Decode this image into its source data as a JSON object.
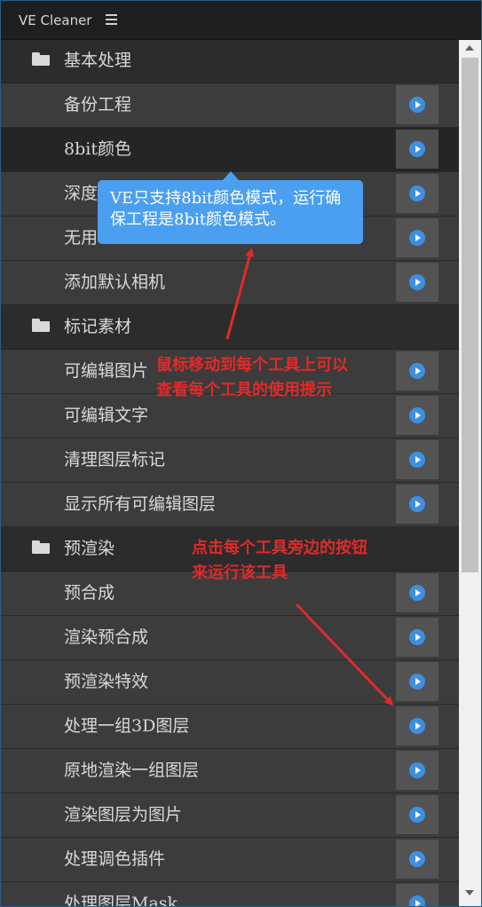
{
  "window": {
    "title": "VE Cleaner"
  },
  "rows": [
    {
      "type": "category",
      "label": "基本处理"
    },
    {
      "type": "tool",
      "label": "备份工程"
    },
    {
      "type": "tool",
      "label": "8bit颜色",
      "selected": true
    },
    {
      "type": "tool",
      "label": "深度"
    },
    {
      "type": "tool",
      "label": "无用"
    },
    {
      "type": "tool",
      "label": "添加默认相机"
    },
    {
      "type": "category",
      "label": "标记素材"
    },
    {
      "type": "tool",
      "label": "可编辑图片"
    },
    {
      "type": "tool",
      "label": "可编辑文字"
    },
    {
      "type": "tool",
      "label": "清理图层标记"
    },
    {
      "type": "tool",
      "label": "显示所有可编辑图层"
    },
    {
      "type": "category",
      "label": "预渲染"
    },
    {
      "type": "tool",
      "label": "预合成"
    },
    {
      "type": "tool",
      "label": "渲染预合成"
    },
    {
      "type": "tool",
      "label": "预渲染特效"
    },
    {
      "type": "tool",
      "label": "处理一组3D图层"
    },
    {
      "type": "tool",
      "label": "原地渲染一组图层"
    },
    {
      "type": "tool",
      "label": "渲染图层为图片"
    },
    {
      "type": "tool",
      "label": "处理调色插件"
    },
    {
      "type": "tool",
      "label": "处理图层Mask"
    }
  ],
  "tooltip": {
    "line1": "VE只支持8bit颜色模式，运行确",
    "line2": "保工程是8bit颜色模式。"
  },
  "annotations": {
    "hover_line1": "鼠标移动到每个工具上可以",
    "hover_line2": "查看每个工具的使用提示",
    "click_line1": "点击每个工具旁边的按钮",
    "click_line2": "来运行该工具"
  },
  "icons": {
    "category": "folder-icon",
    "run": "play-icon",
    "menu": "hamburger-menu-icon"
  },
  "colors": {
    "accent": "#3d8fe0",
    "tooltip": "#4b9ff0",
    "annotation": "#e02a2a"
  }
}
